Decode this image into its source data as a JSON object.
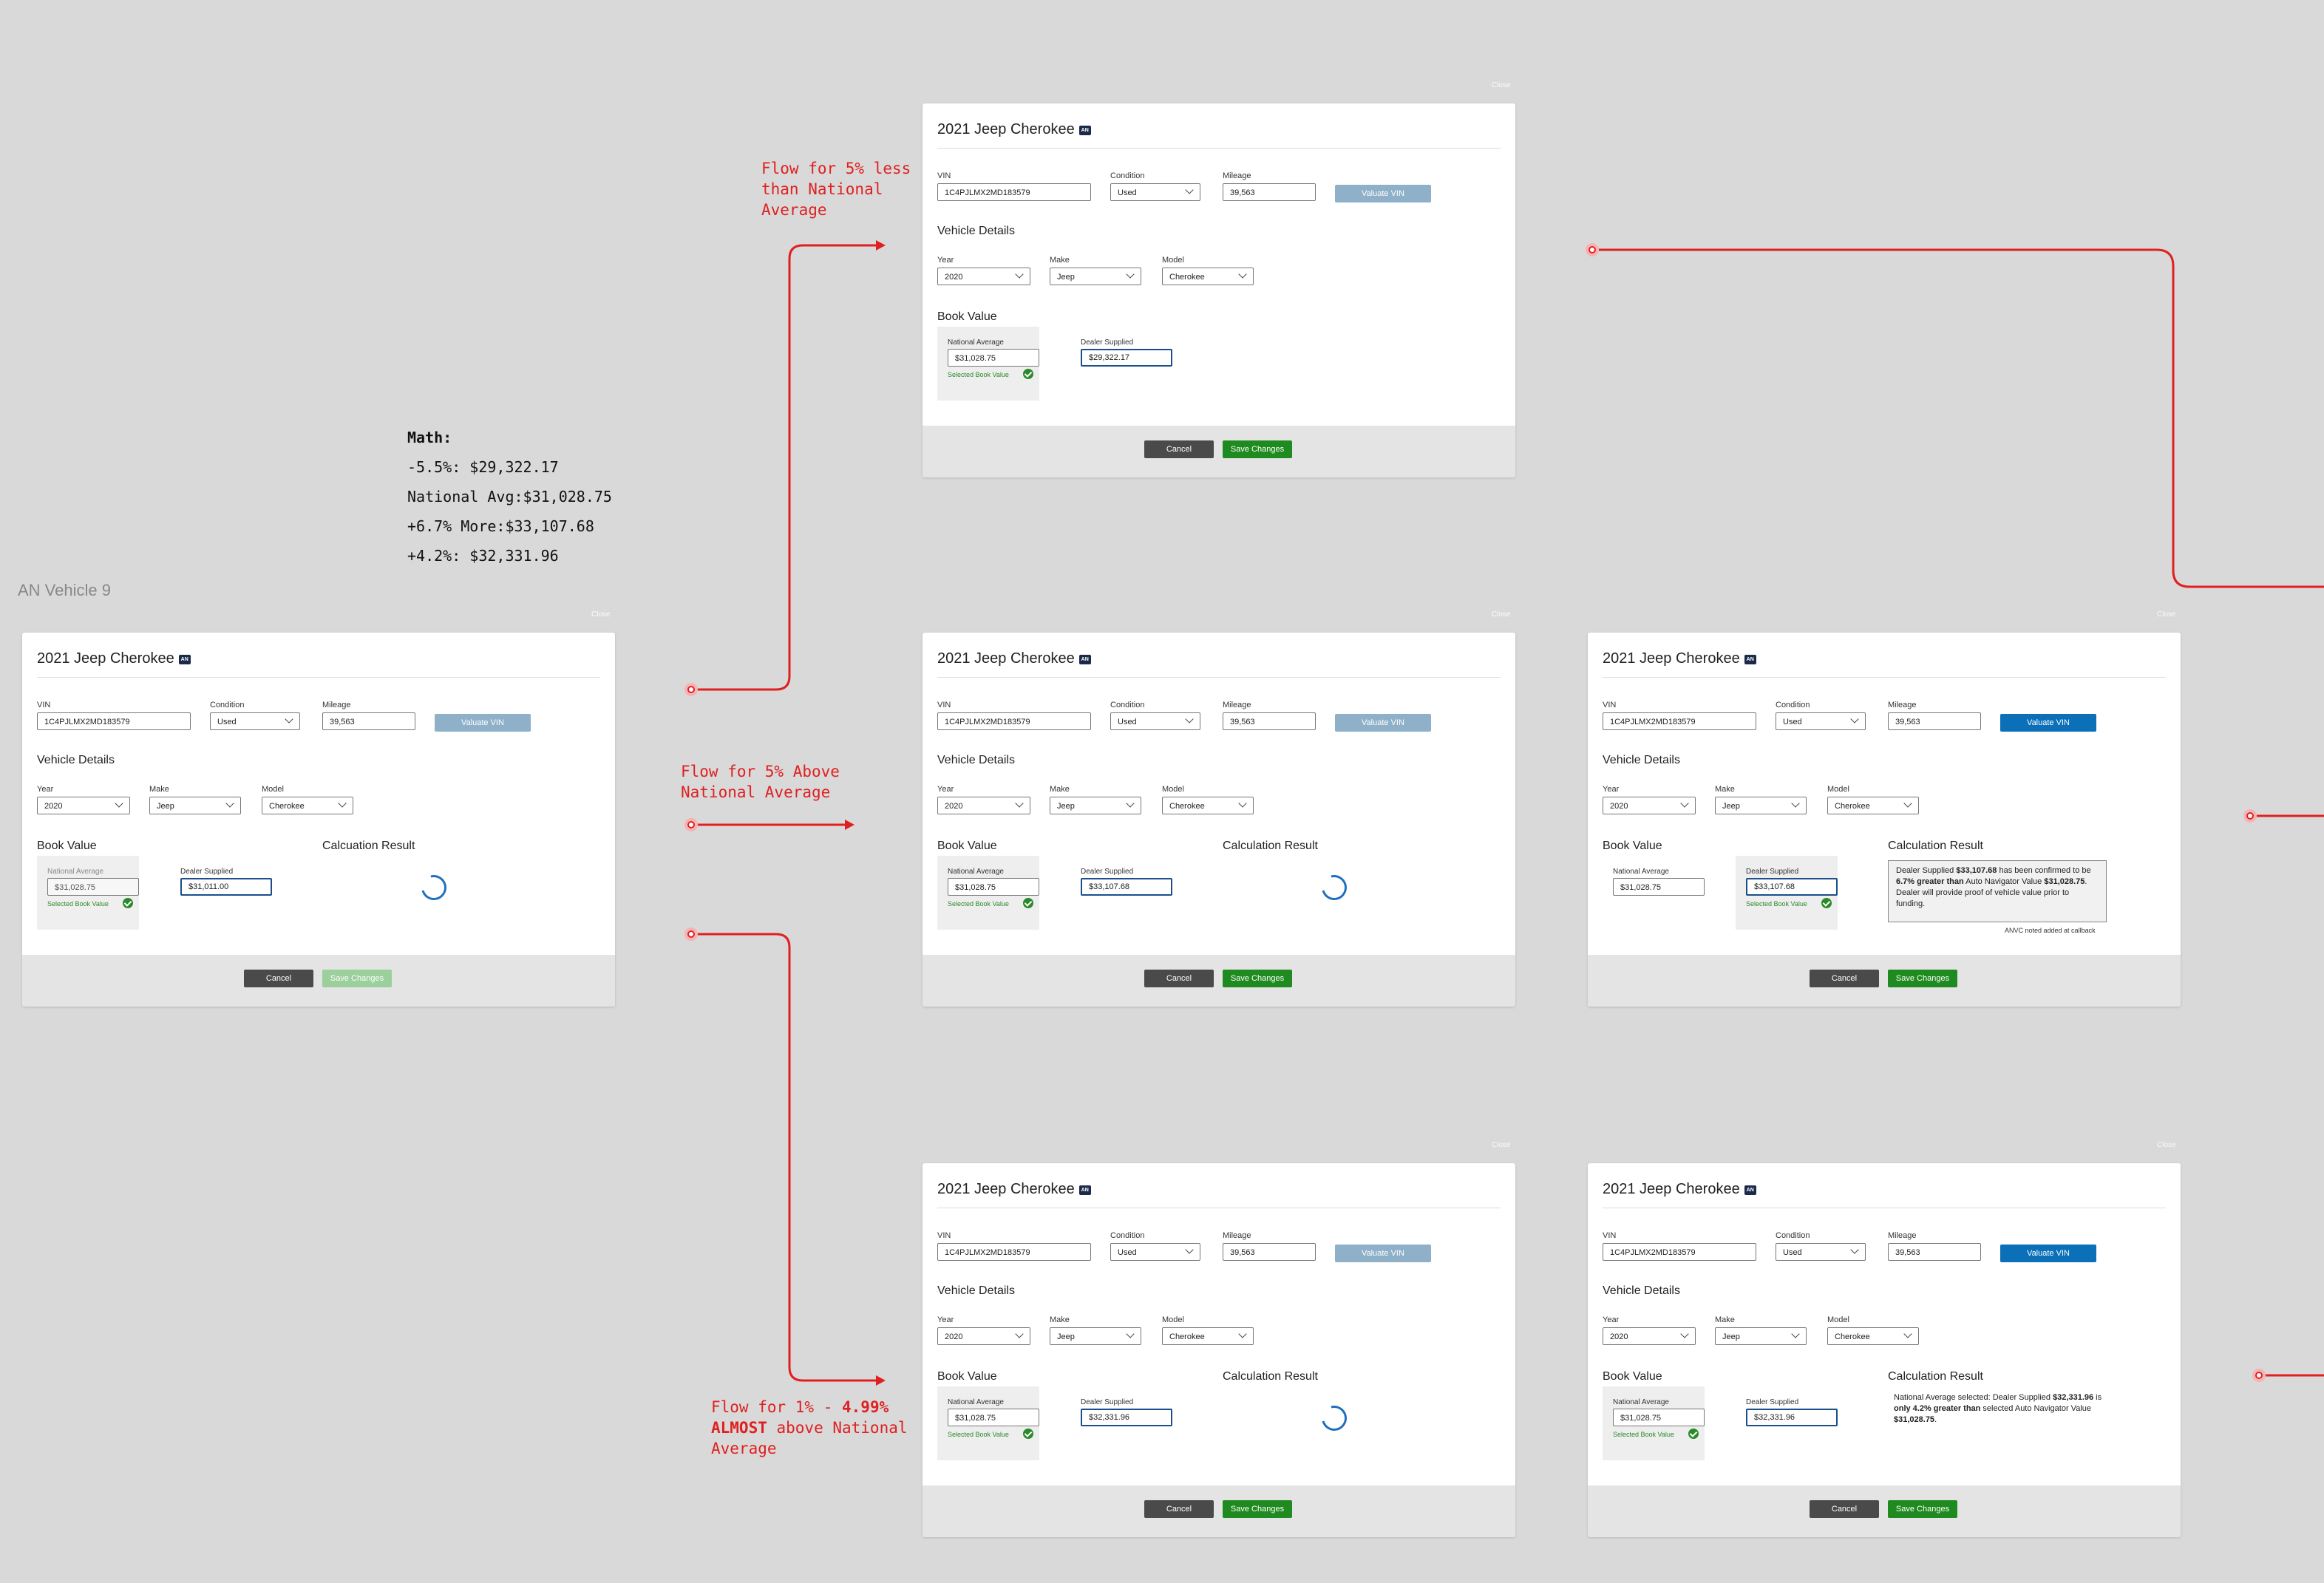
{
  "canvas": {
    "frame_label": "AN Vehicle 9",
    "math": {
      "title": "Math:",
      "lines": [
        "-5.5%: $29,322.17",
        "National Avg:$31,028.75",
        "+6.7% More:$33,107.68",
        "+4.2%: $32,331.96"
      ]
    },
    "notes": {
      "less": "Flow for 5% less\nthan National\nAverage",
      "above": "Flow for 5% Above\nNational Average",
      "almost_prefix": "Flow for  1% - ",
      "almost_bold": "4.99%\nALMOST",
      "almost_suffix": " above National\nAverage"
    },
    "accent_color": "#e02020"
  },
  "common": {
    "close": "Close",
    "title": "2021 Jeep Cherokee",
    "badge": "AN",
    "vin_label": "VIN",
    "vin": "1C4PJLMX2MD183579",
    "condition_label": "Condition",
    "condition": "Used",
    "mileage_label": "Mileage",
    "mileage": "39,563",
    "valuate": "Valuate VIN",
    "vehicle_details": "Vehicle Details",
    "year_label": "Year",
    "year": "2020",
    "make_label": "Make",
    "make": "Jeep",
    "model_label": "Model",
    "model": "Cherokee",
    "book_value": "Book Value",
    "national_average_label": "National Average",
    "national_average": "$31,028.75",
    "dealer_supplied_label": "Dealer Supplied",
    "selected_book_value": "Selected Book Value",
    "calculation_result": "Calculation Result",
    "calculation_result_typo": "Calcuation Result",
    "cancel": "Cancel",
    "save": "Save Changes"
  },
  "modals": {
    "base": {
      "dealer": "$31,011.00"
    },
    "less": {
      "dealer": "$29,322.17"
    },
    "above_loading": {
      "dealer": "$33,107.68"
    },
    "above_result": {
      "dealer": "$33,107.68",
      "r1": "Dealer Supplied ",
      "r2": "$33,107.68",
      "r3": " has been confirmed to be ",
      "r4": "6.7% greater than",
      "r5": " Auto Navigator Value ",
      "r6": "$31,028.75",
      "r7": ". Dealer will provide proof of vehicle value prior to funding.",
      "note": "ANVC noted added at callback"
    },
    "almost_loading": {
      "dealer": "$32,331.96"
    },
    "almost_result": {
      "dealer": "$32,331.96",
      "r1": "National Average selected: Dealer Supplied ",
      "r2": "$32,331.96",
      "r3": " is ",
      "r4": "only 4.2% greater than",
      "r5": " selected Auto Navigator Value ",
      "r6": "$31,028.75",
      "r7": "."
    }
  }
}
